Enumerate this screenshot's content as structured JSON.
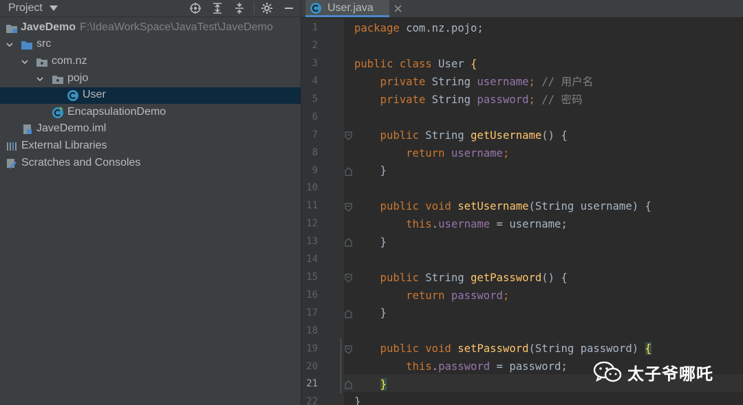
{
  "project_panel": {
    "title": "Project",
    "tree": [
      {
        "label": "JaveDemo",
        "path": "F:\\IdeaWorkSpace\\JavaTest\\JaveDemo"
      },
      {
        "label": "src"
      },
      {
        "label": "com.nz"
      },
      {
        "label": "pojo"
      },
      {
        "label": "User"
      },
      {
        "label": "EncapsulationDemo"
      },
      {
        "label": "JaveDemo.iml"
      },
      {
        "label": "External Libraries"
      },
      {
        "label": "Scratches and Consoles"
      }
    ]
  },
  "editor": {
    "tab_label": "User.java",
    "line_numbers": [
      "1",
      "2",
      "3",
      "4",
      "5",
      "6",
      "7",
      "8",
      "9",
      "10",
      "11",
      "12",
      "13",
      "14",
      "15",
      "16",
      "17",
      "18",
      "19",
      "20",
      "21",
      "22"
    ],
    "active_line": "21",
    "code": {
      "l1_kw": "package",
      "l1_rest": " com.nz.pojo;",
      "l3_kw": "public class",
      "l3_name": " User ",
      "l3_brace": "{",
      "l4_kw": "    private",
      "l4_type": " String ",
      "l4_field": "username",
      "l4_semi": ";",
      "l4_comment": " // 用户名",
      "l5_kw": "    private",
      "l5_type": " String ",
      "l5_field": "password",
      "l5_semi": ";",
      "l5_comment": " // 密码",
      "l7_kw": "    public",
      "l7_type": " String ",
      "l7_method": "getUsername",
      "l7_rest": "() {",
      "l8_kw": "        return",
      "l8_field": " username",
      "l8_semi": ";",
      "l9": "    }",
      "l11_kw": "    public void",
      "l11_method": " setUsername",
      "l11_rest": "(String username) {",
      "l12_kw": "        this",
      "l12_dot": ".",
      "l12_field": "username",
      "l12_rest": " = username;",
      "l13": "    }",
      "l15_kw": "    public",
      "l15_type": " String ",
      "l15_method": "getPassword",
      "l15_rest": "() {",
      "l16_kw": "        return",
      "l16_field": " password",
      "l16_semi": ";",
      "l17": "    }",
      "l19_kw": "    public void",
      "l19_method": " setPassword",
      "l19_rest": "(String password) ",
      "l19_brace": "{",
      "l20_kw": "        this",
      "l20_dot": ".",
      "l20_field": "password",
      "l20_rest": " = password;",
      "l21_indent": "    ",
      "l21_brace": "}",
      "l22": "}"
    }
  },
  "watermark": {
    "text": "太子爷哪吒"
  },
  "colors": {
    "keyword": "#cc7832",
    "field": "#9876aa",
    "method": "#ffc66d",
    "comment": "#808080",
    "selection": "#0d293e"
  }
}
